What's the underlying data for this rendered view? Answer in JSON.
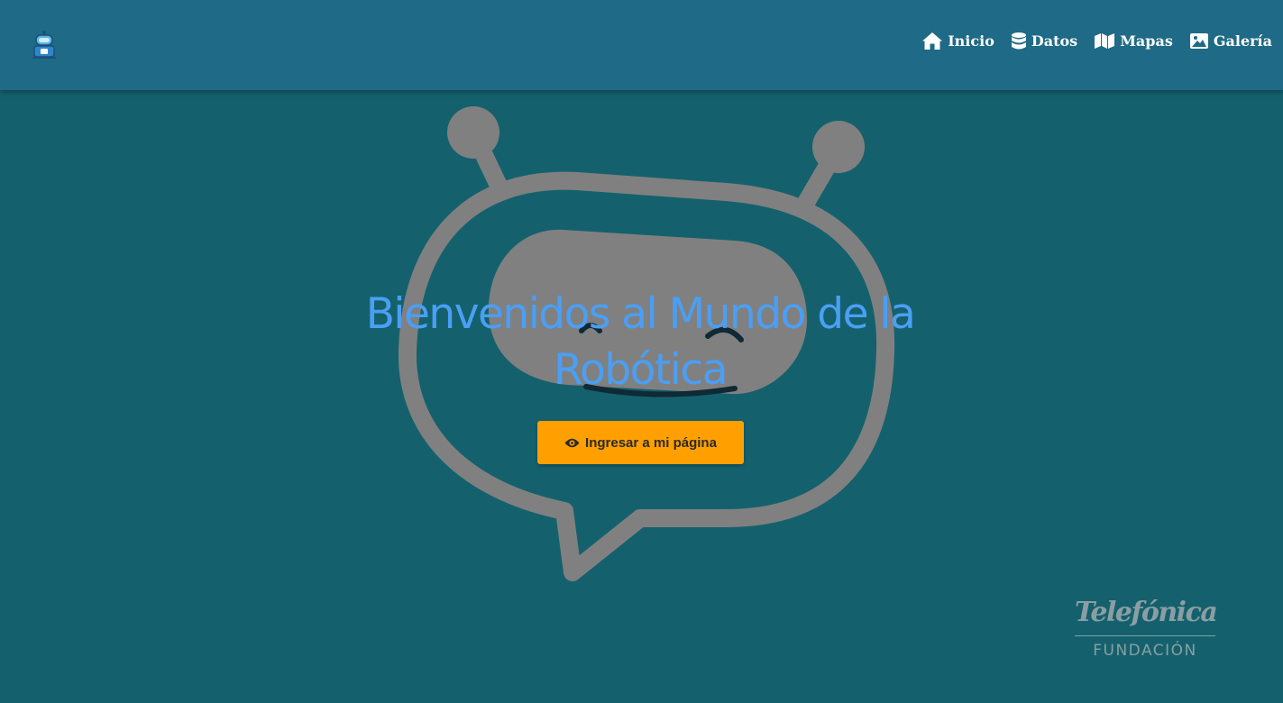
{
  "nav": {
    "logo_icon": "robot-logo-icon",
    "links": [
      {
        "label": "Inicio",
        "icon": "home-icon"
      },
      {
        "label": "Datos",
        "icon": "database-icon"
      },
      {
        "label": "Mapas",
        "icon": "map-icon"
      },
      {
        "label": "Galería",
        "icon": "image-icon"
      }
    ]
  },
  "hero": {
    "title": "Bienvenidos al Mundo de la Robótica",
    "illustration": "robot-chat-bubble",
    "button_label": "Ingresar a mi página",
    "button_icon": "eye-icon"
  },
  "sponsor": {
    "name": "Telefónica",
    "subtitle": "FUNDACIÓN"
  },
  "colors": {
    "page_background": "#14616d",
    "navbar_background": "#1f6a86",
    "title_text": "#4a9ff5",
    "button_background": "#ffa000",
    "illustration_gray": "#808080"
  }
}
